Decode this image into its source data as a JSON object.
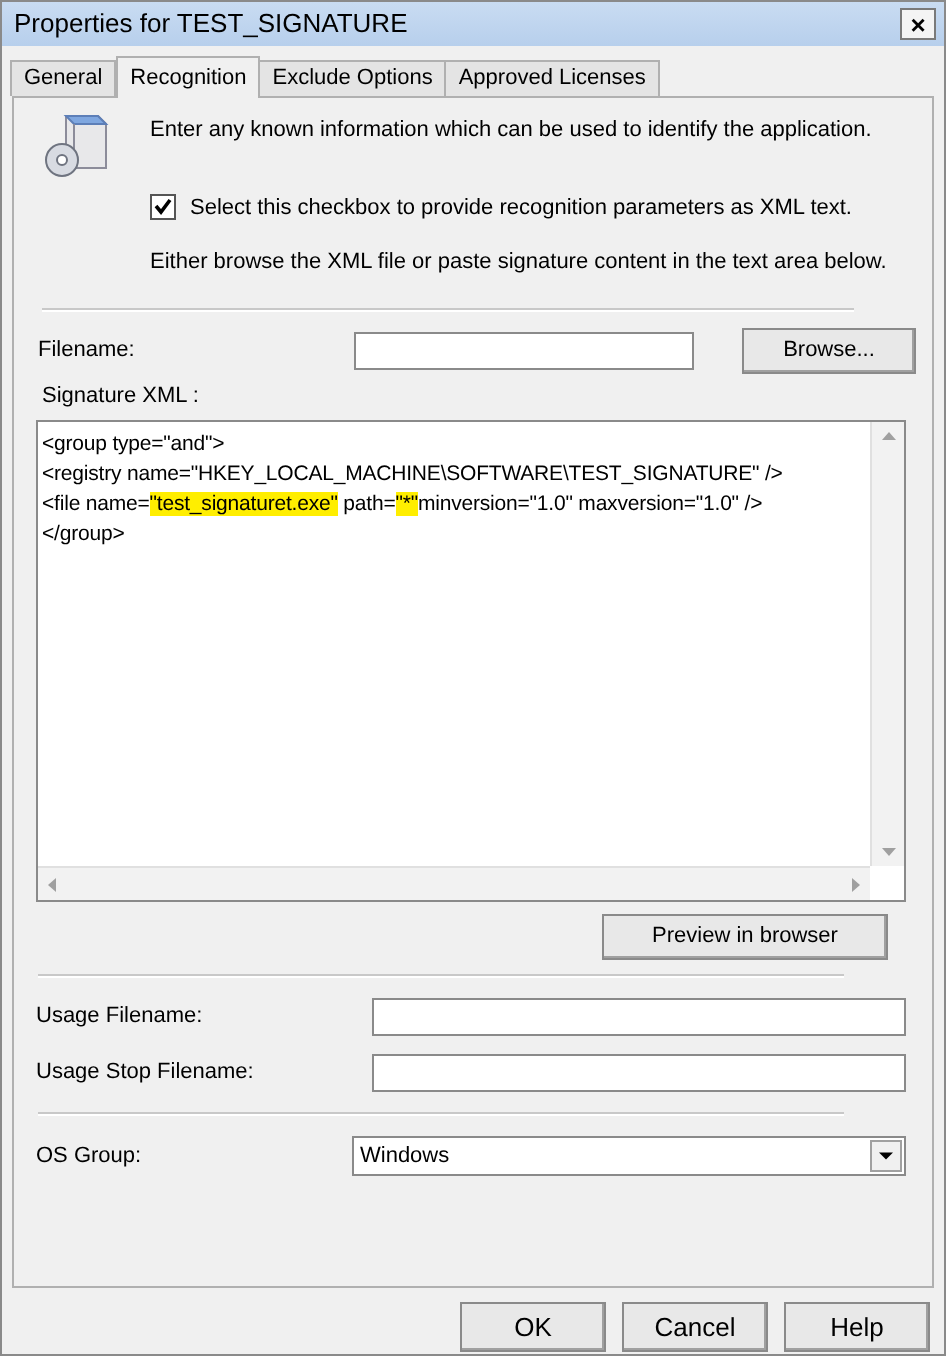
{
  "window": {
    "title": "Properties for TEST_SIGNATURE",
    "close": "×"
  },
  "tabs": [
    {
      "label": "General",
      "selected": false
    },
    {
      "label": "Recognition",
      "selected": true
    },
    {
      "label": "Exclude Options",
      "selected": false
    },
    {
      "label": "Approved Licenses",
      "selected": false
    }
  ],
  "intro": "Enter any known information which can be used to identify the application.",
  "xml_checkbox": {
    "label": "Select this checkbox to provide recognition parameters as XML text.",
    "checked": true
  },
  "hint": "Either browse the XML file or paste signature content in the text area below.",
  "filename": {
    "label": "Filename:",
    "button": "Browse..."
  },
  "signature": {
    "label": "Signature XML :",
    "lines": [
      [
        {
          "text": "<group type=\"and\">",
          "highlighted": false
        }
      ],
      [
        {
          "text": "<registry name=\"HKEY_LOCAL_MACHINE\\SOFTWARE\\TEST_SIGNATURE\" />",
          "highlighted": false
        }
      ],
      [
        {
          "text": "<file name=",
          "highlighted": false
        },
        {
          "text": "\"test_signaturet.exe\"",
          "highlighted": true
        },
        {
          "text": " path=",
          "highlighted": false
        },
        {
          "text": "\"*\"",
          "highlighted": true
        },
        {
          "text": "minversion=\"1.0\" maxversion=\"1.0\" />",
          "highlighted": false
        }
      ],
      [
        {
          "text": "</group>",
          "highlighted": false
        }
      ]
    ]
  },
  "preview_button": "Preview in browser",
  "usage_filename": {
    "label": "Usage Filename:"
  },
  "usage_stop_filename": {
    "label": "Usage Stop Filename:"
  },
  "os_group": {
    "label": "OS Group:",
    "value": "Windows"
  },
  "buttons": [
    "OK",
    "Cancel",
    "Help"
  ]
}
